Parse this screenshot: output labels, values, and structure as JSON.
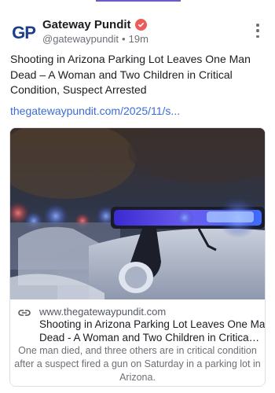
{
  "post": {
    "author": {
      "name": "Gateway Pundit",
      "handle": "@gatewaypundit",
      "separator": "•",
      "time": "19m",
      "avatar_text": "GP"
    },
    "text": "Shooting in Arizona Parking Lot Leaves One Man Dead – A Woman and Two Children in Critical Condition, Suspect Arrested",
    "link_text": "thegatewaypundit.com/2025/11/s..."
  },
  "card": {
    "domain": "www.thegatewaypundit.com",
    "title_line1": "Shooting in Arizona Parking Lot Leaves One Man",
    "title_line2": "Dead - A Woman and Two Children in Critical C...",
    "description": "One man died, and three others are in critical condition after a suspect fired a gun on Saturday in a parking lot in Arizona."
  },
  "colors": {
    "accent": "#6b5cc8",
    "link": "#3b6bd4",
    "verified_badge": "#ee5a5a",
    "avatar": "#1d3f88"
  },
  "icons": {
    "more": "more-vertical-icon",
    "verified": "verified-badge-icon",
    "link": "link-icon"
  }
}
